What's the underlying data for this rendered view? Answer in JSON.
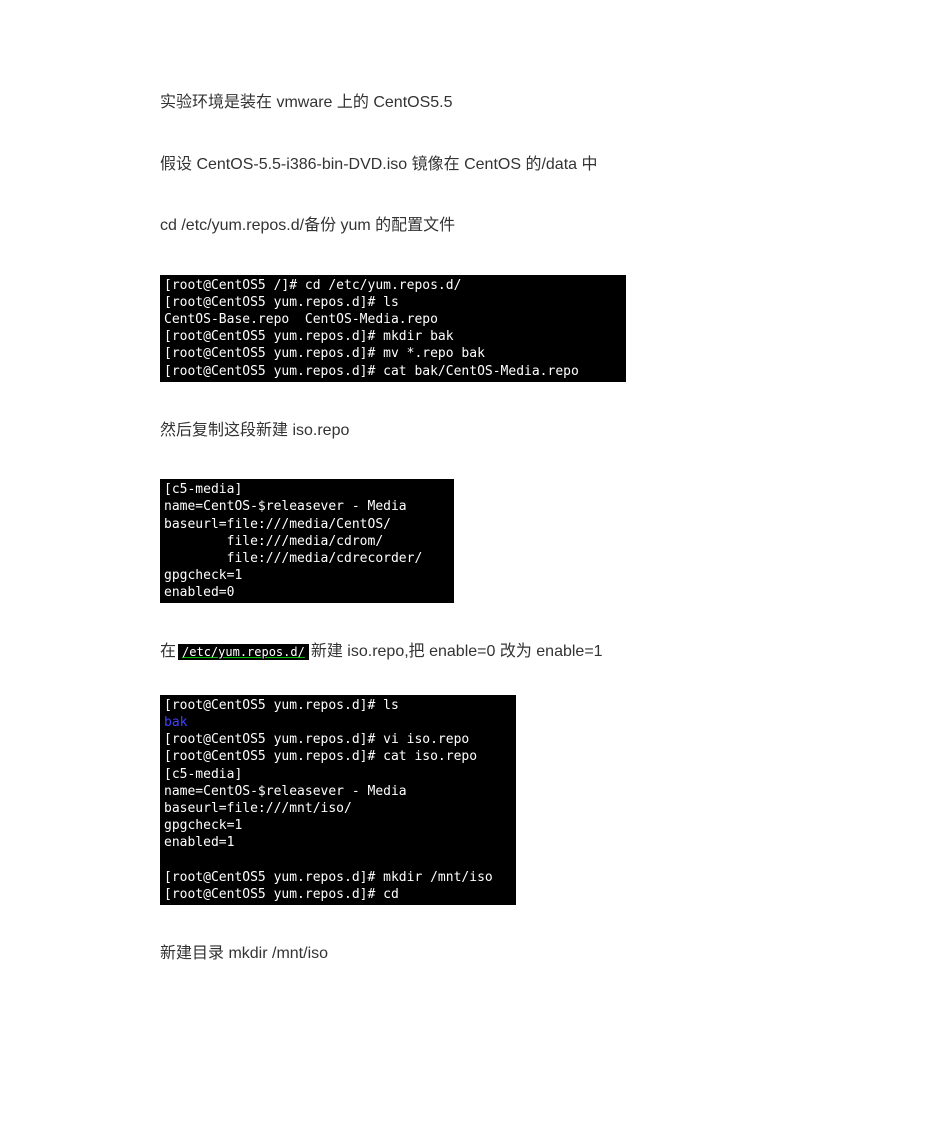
{
  "p1": "实验环境是装在 vmware 上的 CentOS5.5",
  "p2": "假设 CentOS-5.5-i386-bin-DVD.iso 镜像在 CentOS 的/data 中",
  "p3": "cd  /etc/yum.repos.d/备份 yum 的配置文件",
  "term1": "[root@CentOS5 /]# cd /etc/yum.repos.d/\n[root@CentOS5 yum.repos.d]# ls\nCentOS-Base.repo  CentOS-Media.repo\n[root@CentOS5 yum.repos.d]# mkdir bak\n[root@CentOS5 yum.repos.d]# mv *.repo bak\n[root@CentOS5 yum.repos.d]# cat bak/CentOS-Media.repo",
  "p4": "然后复制这段新建 iso.repo",
  "term2": "[c5-media]\nname=CentOS-$releasever - Media\nbaseurl=file:///media/CentOS/\n        file:///media/cdrom/\n        file:///media/cdrecorder/\ngpgcheck=1\nenabled=0",
  "p5_pre": "在",
  "p5_chip": "/etc/yum.repos.d/",
  "p5_post": "新建 iso.repo,把 enable=0 改为 enable=1",
  "term3_l1": "[root@CentOS5 yum.repos.d]# ls",
  "term3_bak": "bak",
  "term3_body": "[root@CentOS5 yum.repos.d]# vi iso.repo\n[root@CentOS5 yum.repos.d]# cat iso.repo\n[c5-media]\nname=CentOS-$releasever - Media\nbaseurl=file:///mnt/iso/\ngpgcheck=1\nenabled=1\n\n[root@CentOS5 yum.repos.d]# mkdir /mnt/iso\n[root@CentOS5 yum.repos.d]# cd",
  "p6": "新建目录 mkdir  /mnt/iso"
}
